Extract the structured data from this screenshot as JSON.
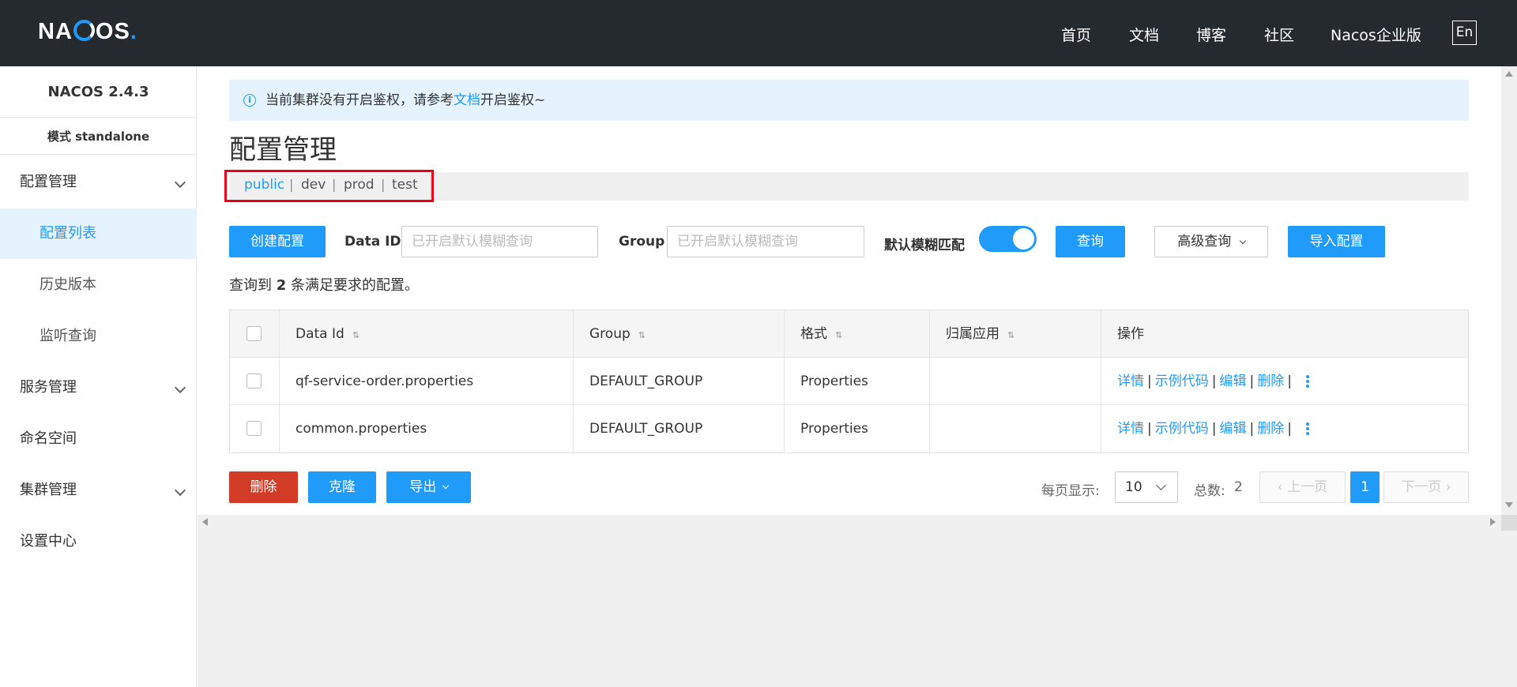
{
  "topbar": {
    "logo_text": "NACOS.",
    "nav": [
      "首页",
      "文档",
      "博客",
      "社区",
      "Nacos企业版"
    ],
    "lang": "En"
  },
  "sidebar": {
    "version": "NACOS 2.4.3",
    "mode": "模式 standalone",
    "items": [
      {
        "label": "配置管理",
        "expandable": true
      },
      {
        "label": "配置列表",
        "active": true
      },
      {
        "label": "历史版本"
      },
      {
        "label": "监听查询"
      },
      {
        "label": "服务管理",
        "expandable": true
      },
      {
        "label": "命名空间"
      },
      {
        "label": "集群管理",
        "expandable": true
      },
      {
        "label": "设置中心"
      }
    ]
  },
  "notice": {
    "prefix": "当前集群没有开启鉴权，请参考",
    "link": "文档",
    "suffix": "开启鉴权~"
  },
  "page_title": "配置管理",
  "namespaces": [
    "public",
    "dev",
    "prod",
    "test"
  ],
  "active_namespace": "public",
  "namespace_separator": "|",
  "filters": {
    "create_button": "创建配置",
    "dataid_label": "Data ID",
    "dataid_placeholder": "已开启默认模糊查询",
    "group_label": "Group",
    "group_placeholder": "已开启默认模糊查询",
    "fuzzy_label": "默认模糊匹配",
    "fuzzy_on": true,
    "query_button": "查询",
    "advanced_button": "高级查询",
    "import_button": "导入配置"
  },
  "result": {
    "prefix": "查询到",
    "count": "2",
    "suffix": "条满足要求的配置。"
  },
  "table": {
    "headers": [
      "Data Id",
      "Group",
      "格式",
      "归属应用",
      "操作"
    ],
    "rows": [
      {
        "data_id": "qf-service-order.properties",
        "group": "DEFAULT_GROUP",
        "format": "Properties",
        "app": ""
      },
      {
        "data_id": "common.properties",
        "group": "DEFAULT_GROUP",
        "format": "Properties",
        "app": ""
      }
    ],
    "actions": [
      "详情",
      "示例代码",
      "编辑",
      "删除"
    ],
    "action_separator": "|"
  },
  "bulk": {
    "delete": "删除",
    "clone": "克隆",
    "export": "导出"
  },
  "pager": {
    "page_size_label": "每页显示:",
    "page_size": "10",
    "total_label": "总数:",
    "total": "2",
    "prev": "上一页",
    "current": "1",
    "next": "下一页"
  },
  "colors": {
    "topbar_bg": "#252a2f",
    "primary": "#209bfa",
    "danger": "#d23c26",
    "highlight_border": "#e5001c",
    "sidebar_active_bg": "#e4f3fe"
  }
}
